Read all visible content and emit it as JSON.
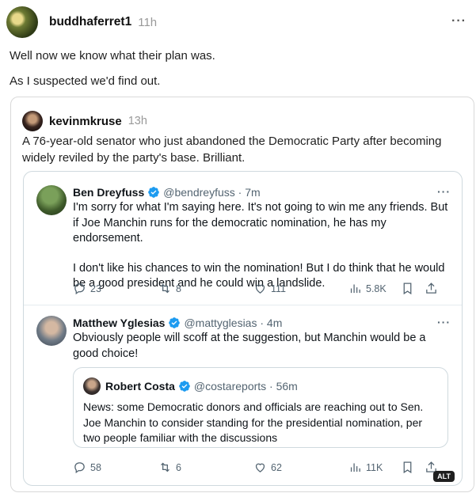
{
  "post": {
    "username": "buddhaferret1",
    "time": "11h",
    "lines": [
      "Well now we know what their plan was.",
      "As I suspected we'd find out."
    ]
  },
  "quote": {
    "username": "kevinmkruse",
    "time": "13h",
    "text": "A 76-year-old senator who just abandoned the Democratic Party after becoming widely reviled by the party's base. Brilliant."
  },
  "tweets": [
    {
      "name": "Ben Dreyfuss",
      "handle": "@bendreyfuss · 7m",
      "paragraphs": [
        "I'm sorry for what I'm saying here. It's not going to win me any friends. But if Joe Manchin runs for the democratic nomination, he has my endorsement.",
        "I don't like his chances to win the nomination! But I do think that he would be a good president and he could win a landslide."
      ],
      "replies": "23",
      "reposts": "8",
      "likes": "111",
      "views": "5.8K"
    },
    {
      "name": "Matthew Yglesias",
      "handle": "@mattyglesias · 4m",
      "paragraphs": [
        "Obviously people will scoff at the suggestion, but Manchin would be a good choice!"
      ],
      "quoted": {
        "name": "Robert Costa",
        "handle": "@costareports · 56m",
        "text": "News: some Democratic donors and officials are reaching out to Sen. Joe Manchin to consider standing for the presidential nomination, per two people familiar with the discussions"
      },
      "replies": "58",
      "reposts": "6",
      "likes": "62",
      "views": "11K"
    }
  ],
  "alt_badge": "ALT",
  "icons": [
    "reply-icon",
    "repost-icon",
    "like-icon",
    "views-icon",
    "bookmark-icon",
    "share-icon",
    "verified-icon",
    "more-icon"
  ]
}
